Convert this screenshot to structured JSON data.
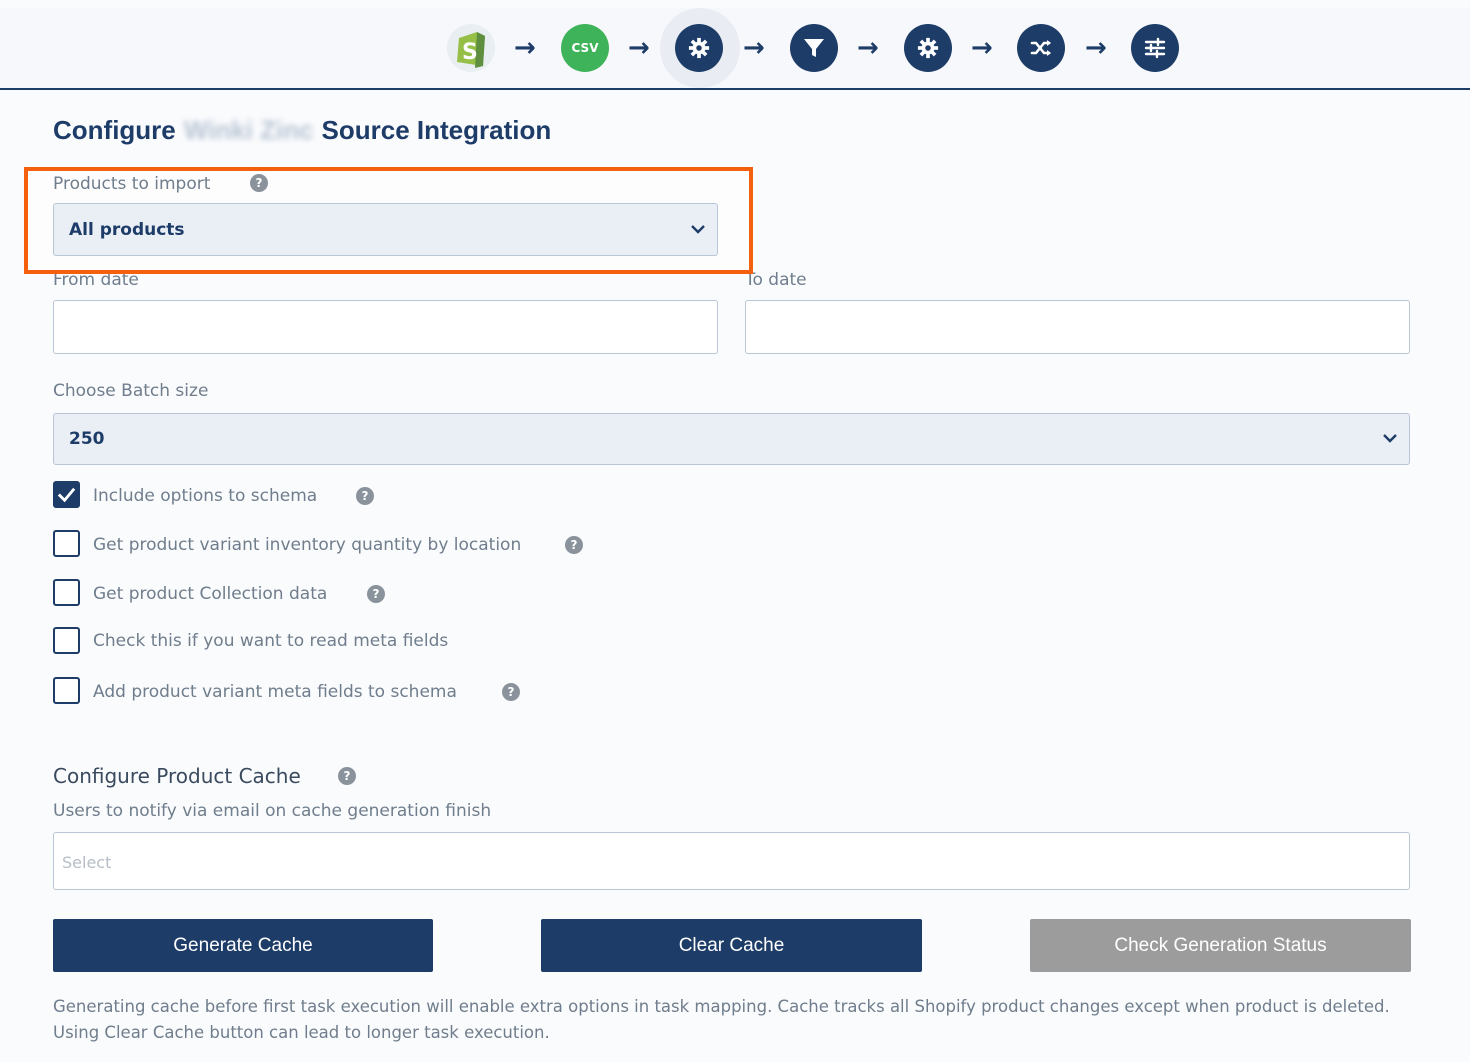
{
  "stepper": {
    "steps": [
      {
        "name": "shopify-icon",
        "kind": "shopify"
      },
      {
        "name": "csv-icon",
        "kind": "csv",
        "text": "CSV"
      },
      {
        "name": "settings-icon",
        "kind": "gear",
        "active": true
      },
      {
        "name": "filter-icon",
        "kind": "filter"
      },
      {
        "name": "settings-icon",
        "kind": "gear"
      },
      {
        "name": "shuffle-icon",
        "kind": "shuffle"
      },
      {
        "name": "list-settings-icon",
        "kind": "sliders"
      }
    ],
    "arrow_glyph": "→",
    "accent_color": "#1d3c68",
    "green_color": "#3fb35a"
  },
  "title": {
    "prefix": "Configure",
    "blurred": "Winki Zinc",
    "suffix": "Source Integration"
  },
  "products_to_import": {
    "label": "Products to import",
    "value": "All products"
  },
  "from_date": {
    "label": "From date",
    "value": ""
  },
  "to_date": {
    "label": "To date",
    "value": ""
  },
  "batch_size": {
    "label": "Choose Batch size",
    "value": "250"
  },
  "checkboxes": [
    {
      "label": "Include options to schema",
      "checked": true,
      "help": true
    },
    {
      "label": "Get product variant inventory quantity by location",
      "checked": false,
      "help": true
    },
    {
      "label": "Get product Collection data",
      "checked": false,
      "help": true
    },
    {
      "label": "Check this if you want to read meta fields",
      "checked": false,
      "help": false
    },
    {
      "label": "Add product variant meta fields to schema",
      "checked": false,
      "help": true
    }
  ],
  "cache": {
    "heading": "Configure Product Cache",
    "notify_label": "Users to notify via email on cache generation finish",
    "notify_placeholder": "Select"
  },
  "buttons": {
    "generate": "Generate Cache",
    "clear": "Clear Cache",
    "status": "Check Generation Status"
  },
  "help_glyph": "?",
  "footnote": "Generating cache before first task execution will enable extra options in task mapping. Cache tracks all Shopify product changes except when product is deleted. Using Clear Cache button can lead to longer task execution.",
  "highlight_color": "#f4600b"
}
